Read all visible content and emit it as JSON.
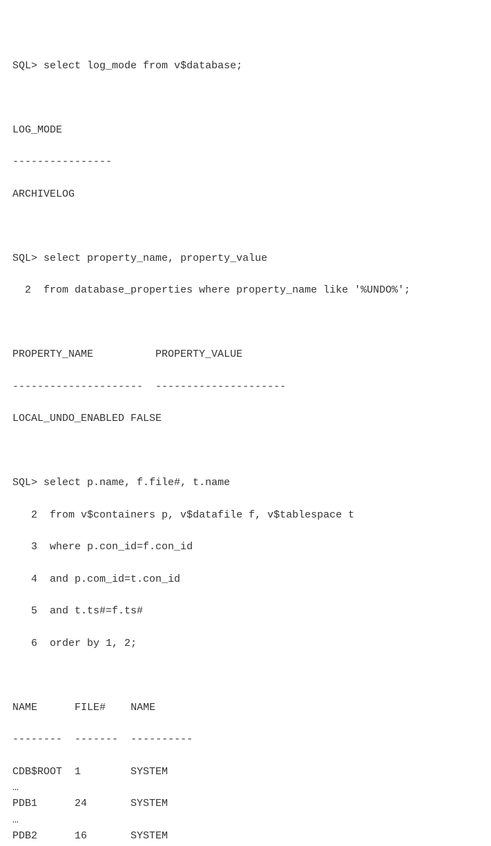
{
  "q1": {
    "prompt": "SQL>",
    "sql": "select log_mode from v$database;",
    "header": "LOG_MODE",
    "rule": "----------------",
    "row": "ARCHIVELOG"
  },
  "q2": {
    "prompt1": "SQL>",
    "sql_line1": "select property_name, property_value",
    "cont2": "  2",
    "sql_line2": "from database_properties where property_name like '%UNDO%';",
    "header1": "PROPERTY_NAME",
    "header2": "PROPERTY_VALUE",
    "rule1": "---------------------",
    "rule2": "---------------------",
    "row_name": "LOCAL_UNDO_ENABLED",
    "row_value": "FALSE"
  },
  "q3": {
    "prompt1": "SQL>",
    "sql_line1": "select p.name, f.file#, t.name",
    "cont2": "   2",
    "sql_line2": "from v$containers p, v$datafile f, v$tablespace t",
    "cont3": "   3",
    "sql_line3": "where p.con_id=f.con_id",
    "cont4": "   4",
    "sql_line4": "and p.com_id=t.con_id",
    "cont5": "   5",
    "sql_line5": "and t.ts#=f.ts#",
    "cont6": "   6",
    "sql_line6": "order by 1, 2;",
    "hdr_name": "NAME",
    "hdr_file": "FILE#",
    "hdr_name2": "NAME",
    "rule_name": "--------",
    "rule_file": "-------",
    "rule_name2": "----------",
    "rows": [
      {
        "name": "CDB$ROOT",
        "file": "1",
        "tname": "SYSTEM"
      },
      {
        "ellipsis": "…"
      },
      {
        "name": "PDB1",
        "file": "24",
        "tname": "SYSTEM"
      },
      {
        "ellipsis": "…"
      },
      {
        "name": "PDB2",
        "file": "16",
        "tname": "SYSTEM"
      }
    ]
  }
}
